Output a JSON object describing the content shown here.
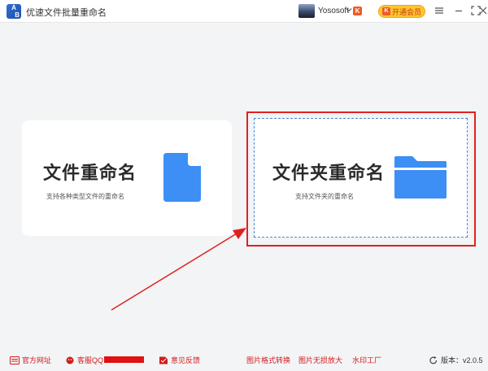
{
  "app": {
    "title": "优速文件批量重命名",
    "logo_text_top": "A",
    "logo_text_bottom": "B"
  },
  "header": {
    "username": "Yososoft",
    "vip_mark": "K",
    "open_vip_label": "开通会员",
    "open_vip_icon": "K"
  },
  "cards": {
    "file": {
      "title": "文件重命名",
      "subtitle": "支持各种类型文件的重命名",
      "icon": "file-icon",
      "color": "#3d8ef5"
    },
    "folder": {
      "title": "文件夹重命名",
      "subtitle": "支持文件夹的重命名",
      "icon": "folder-icon",
      "color": "#3d8ef5"
    }
  },
  "annotation": {
    "color": "#e02020"
  },
  "footer": {
    "site_label": "官方网址",
    "qq_label": "客服QQ",
    "feedback_label": "意见反馈",
    "convert_label": "图片格式转换",
    "enlarge_label": "图片无损放大",
    "watermark_label": "水印工厂",
    "version_label": "版本：v2.0.5"
  }
}
